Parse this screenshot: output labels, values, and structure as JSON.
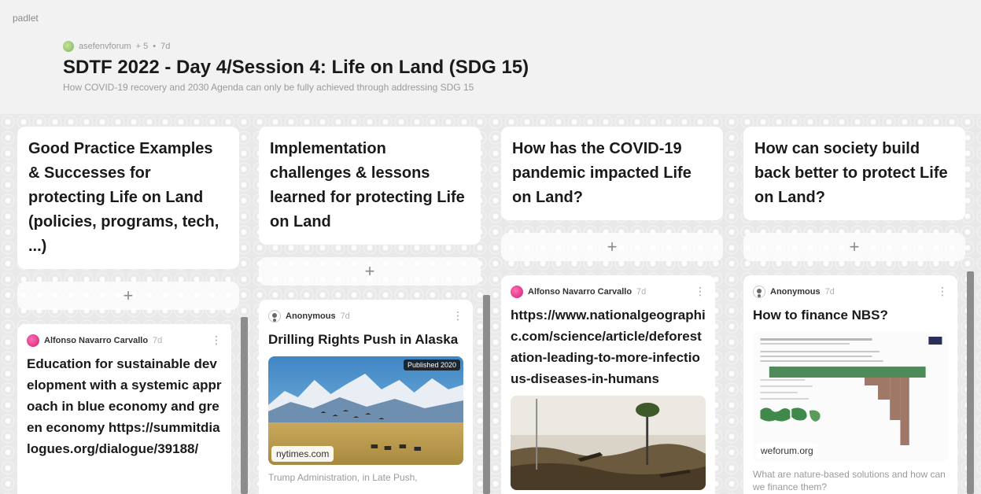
{
  "app": {
    "brand": "padlet"
  },
  "board": {
    "author": "asefenvforum",
    "likes": "+ 5",
    "separator": "•",
    "age": "7d",
    "title": "SDTF 2022 - Day 4/Session 4: Life on Land (SDG 15)",
    "subtitle": "How COVID-19 recovery and 2030 Agenda can only be fully achieved through addressing SDG 15"
  },
  "columns": [
    {
      "title": "Good Practice Examples & Successes for protecting Life on Land (policies, programs, tech, ...)",
      "add_label": "+",
      "post": {
        "author": "Alfonso Navarro Carvallo",
        "time": "7d",
        "menu": "⋮",
        "body": "Education for sustainable development with a systemic approach in blue economy and green economy https://summitdialogues.org/dialogue/39188/"
      }
    },
    {
      "title": "Implementation challenges & lessons learned for protecting Life on Land",
      "add_label": "+",
      "post": {
        "author": "Anonymous",
        "time": "7d",
        "menu": "⋮",
        "title": "Drilling Rights Push in Alaska",
        "image_badge": "Published 2020",
        "image_domain": "nytimes.com",
        "caption": "Trump Administration, in Late Push,"
      }
    },
    {
      "title": "How has the COVID-19 pandemic impacted Life on Land?",
      "add_label": "+",
      "post": {
        "author": "Alfonso Navarro Carvallo",
        "time": "7d",
        "menu": "⋮",
        "title": "https://www.nationalgeographic.com/science/article/deforestation-leading-to-more-infectious-diseases-in-humans"
      }
    },
    {
      "title": "How can society build back better to protect Life on Land?",
      "add_label": "+",
      "post": {
        "author": "Anonymous",
        "time": "7d",
        "menu": "⋮",
        "title": "How to finance NBS?",
        "image_domain": "weforum.org",
        "caption": "What are nature-based solutions and how can we finance them?"
      }
    }
  ]
}
